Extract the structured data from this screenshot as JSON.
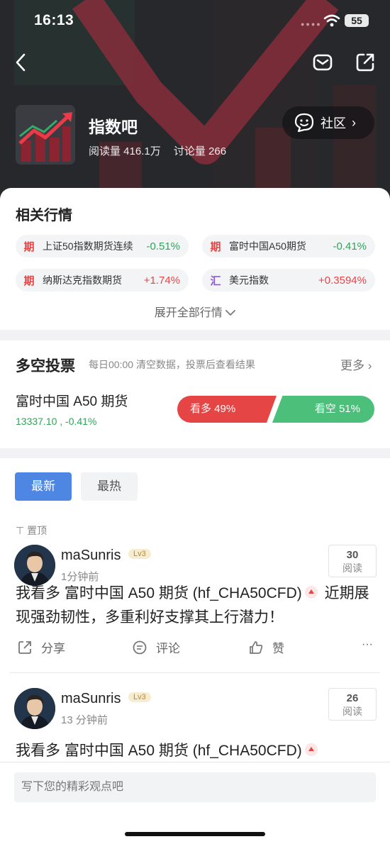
{
  "status_bar": {
    "time": "16:13",
    "battery": "55"
  },
  "header": {
    "forum_name": "指数吧",
    "read_count": "阅读量 416.1万",
    "discuss_count": "讨论量 266",
    "community_label": "社区"
  },
  "market": {
    "title": "相关行情",
    "items": [
      {
        "tag": "期",
        "name": "上证50指数期货连续",
        "change": "-0.51%",
        "color": "#2fa55a"
      },
      {
        "tag": "期",
        "name": "富时中国A50期货",
        "change": "-0.41%",
        "color": "#2fa55a"
      },
      {
        "tag": "期",
        "name": "纳斯达克指数期货",
        "change": "+1.74%",
        "color": "#e64545"
      },
      {
        "tag": "汇",
        "name": "美元指数",
        "change": "+0.3594%",
        "color": "#e64545"
      }
    ],
    "expand_label": "展开全部行情"
  },
  "vote": {
    "title": "多空投票",
    "subtitle": "每日00:00 清空数据，投票后查看结果",
    "more_label": "更多",
    "instrument": "富时中国 A50 期货",
    "price_line": "13337.10 , -0.41%",
    "bull_label": "看多 49%",
    "bear_label": "看空 51%"
  },
  "feed": {
    "tabs": [
      "最新",
      "最热"
    ],
    "pinned_label": "置顶",
    "posts": [
      {
        "user": "maSunris",
        "level": "Lv3",
        "time": "1分钟前",
        "reads": "30",
        "reads_label": "阅读",
        "text_a": "我看多 富时中国 A50 期货 (hf_CHA50CFD)",
        "text_b": "近期展现强劲韧性，多重利好支撑其上行潜力！"
      },
      {
        "user": "maSunris",
        "level": "Lv3",
        "time": "13 分钟前",
        "reads": "26",
        "reads_label": "阅读",
        "text_a": "我看多 富时中国 A50 期货 (hf_CHA50CFD)",
        "text_b": ""
      }
    ],
    "actions": {
      "share": "分享",
      "comment": "评论",
      "like": "赞",
      "more": "···"
    }
  },
  "comment_box": {
    "placeholder": "写下您的精彩观点吧"
  },
  "colors": {
    "accent_blue": "#4e86e4",
    "up_red": "#e64545",
    "down_green": "#2fa55a"
  }
}
